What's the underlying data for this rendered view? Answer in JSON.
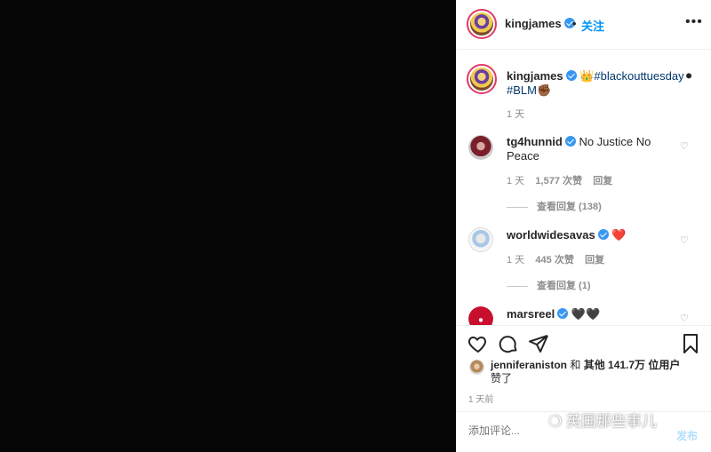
{
  "header": {
    "username": "kingjames",
    "separator": "•",
    "follow_label": "关注",
    "more_label": "•••"
  },
  "caption": {
    "username": "kingjames",
    "text_emoji": "👑",
    "hashtag1": "#blackouttuesday",
    "emoji2": "⚫",
    "hashtag2": "#BLM",
    "emoji3": "✊🏾",
    "time": "1 天"
  },
  "comments": [
    {
      "username": "tg4hunnid",
      "text": "No Justice No Peace",
      "time": "1 天",
      "likes": "1,577 次赞",
      "reply": "回复",
      "view_replies": "查看回复 (138)"
    },
    {
      "username": "worldwidesavas",
      "text": "❤️",
      "time": "1 天",
      "likes": "445 次赞",
      "reply": "回复",
      "view_replies": "查看回复 (1)"
    },
    {
      "username": "marsreel",
      "text": "🖤🖤"
    }
  ],
  "actions": {
    "like_icon": "heart-icon",
    "comment_icon": "comment-icon",
    "share_icon": "share-icon",
    "save_icon": "bookmark-icon"
  },
  "likes": {
    "first_user": "jenniferaniston",
    "joiner": " 和 ",
    "others": "其他 141.7万 位用户",
    "suffix": "赞了"
  },
  "post_time": "1 天前",
  "comment_box": {
    "placeholder": "添加评论...",
    "post_label": "发布"
  },
  "watermark": "英国那些事儿"
}
